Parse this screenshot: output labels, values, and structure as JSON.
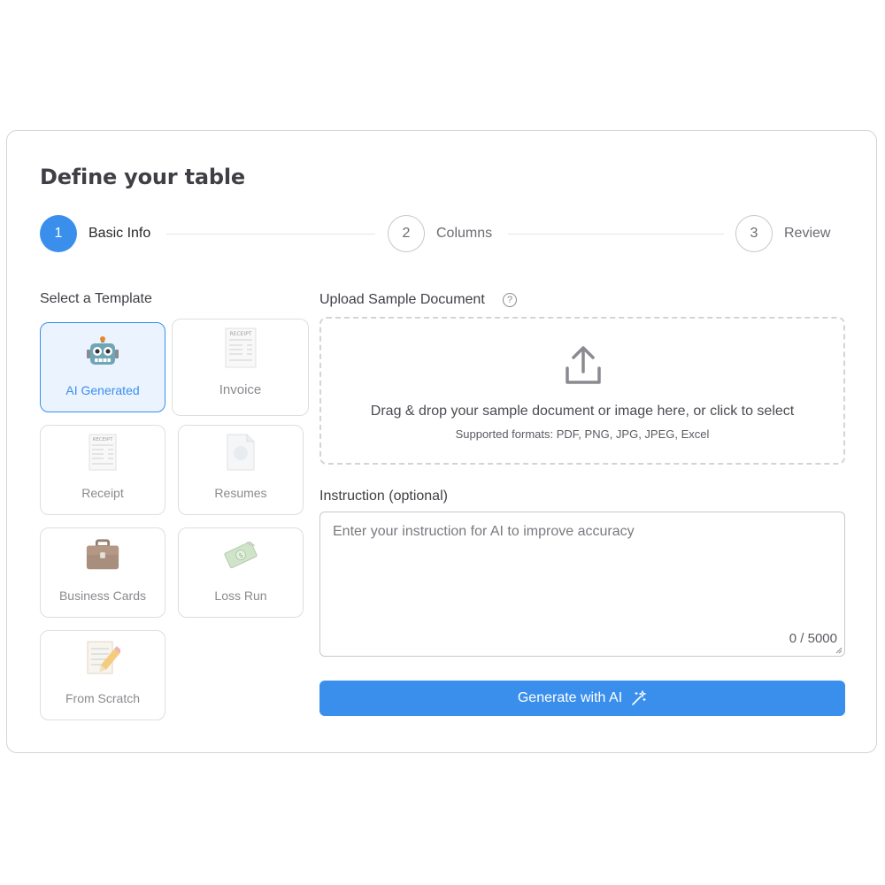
{
  "page_title": "Define your table",
  "steps": [
    {
      "number": "1",
      "label": "Basic Info",
      "state": "active"
    },
    {
      "number": "2",
      "label": "Columns",
      "state": "inactive"
    },
    {
      "number": "3",
      "label": "Review",
      "state": "inactive"
    }
  ],
  "templates": {
    "label": "Select a Template",
    "items": [
      {
        "label": "AI Generated",
        "icon": "robot-icon",
        "selected": true
      },
      {
        "label": "Invoice",
        "icon": "invoice-icon",
        "selected": false
      },
      {
        "label": "Receipt",
        "icon": "receipt-icon",
        "selected": false
      },
      {
        "label": "Resumes",
        "icon": "resume-icon",
        "selected": false
      },
      {
        "label": "Business Cards",
        "icon": "briefcase-icon",
        "selected": false
      },
      {
        "label": "Loss Run",
        "icon": "money-icon",
        "selected": false
      },
      {
        "label": "From Scratch",
        "icon": "memo-pencil-icon",
        "selected": false
      }
    ]
  },
  "upload": {
    "label": "Upload Sample Document",
    "help": "?",
    "main_text": "Drag & drop your sample document or image here, or click to select",
    "sub_text": "Supported formats: PDF, PNG, JPG, JPEG, Excel"
  },
  "instruction": {
    "label": "Instruction (optional)",
    "placeholder": "Enter your instruction for AI to improve accuracy",
    "counter": "0 / 5000"
  },
  "generate_button": {
    "label": "Generate with AI"
  },
  "colors": {
    "accent": "#3b8fec",
    "selected_bg": "#eaf3fe",
    "border": "#dedee2"
  }
}
